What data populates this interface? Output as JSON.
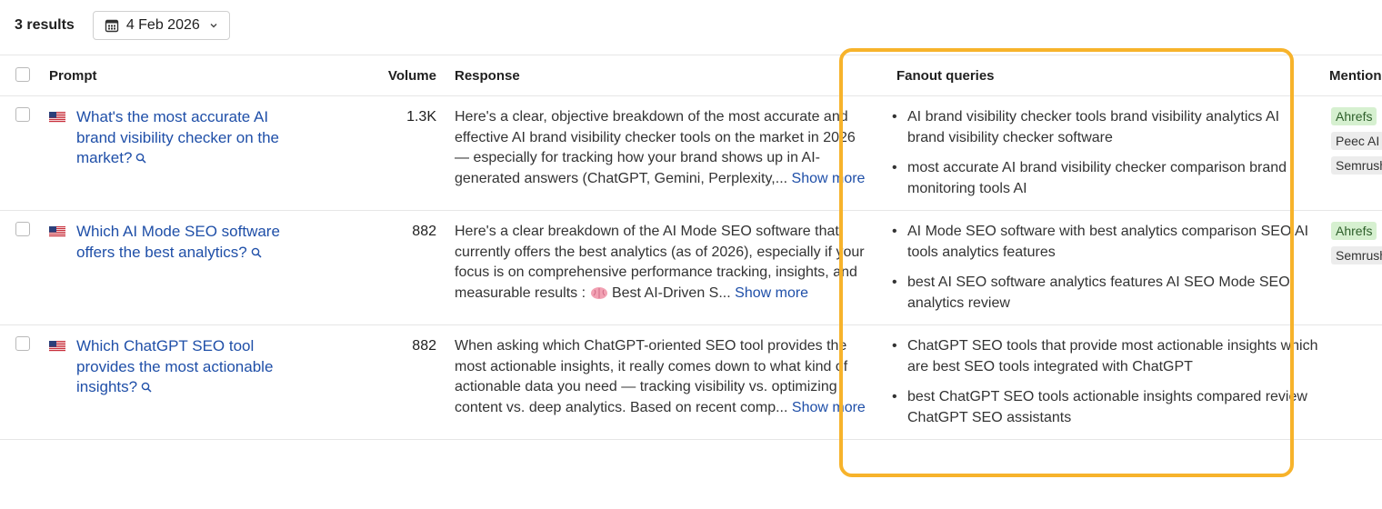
{
  "toolbar": {
    "results_label": "3 results",
    "date_label": "4 Feb 2026",
    "date_icon": "calendar-icon",
    "dropdown_icon": "chevron-down-icon"
  },
  "table": {
    "headers": {
      "prompt": "Prompt",
      "volume": "Volume",
      "response": "Response",
      "fanout": "Fanout queries",
      "mentions": "Mentions"
    },
    "rows": [
      {
        "prompt": "What's the most accurate AI brand visibility checker on the market?",
        "volume": "1.3K",
        "response": "Here's a clear, objective breakdown of the most accurate and effective AI brand visibility checker tools on the market in 2026 — especially for tracking how your brand shows up in AI-generated answers (ChatGPT, Gemini, Perplexity,...",
        "response_tail": "",
        "show_more": "Show more",
        "fanout": [
          "AI brand visibility checker tools brand visibility analytics AI brand visibility checker software",
          "most accurate AI brand visibility checker comparison brand monitoring tools AI"
        ],
        "mentions": [
          {
            "label": "Ahrefs",
            "color": "#d6f0d0"
          },
          {
            "label": "Peec AI",
            "color": "#ececec"
          },
          {
            "label": "Semrush",
            "color": "#ececec"
          }
        ]
      },
      {
        "prompt": "Which AI Mode SEO software offers the best analytics?",
        "volume": "882",
        "response": "Here's a clear breakdown of the AI Mode SEO software that currently offers the best analytics (as of 2026), especially if your focus is on comprehensive performance tracking, insights, and measurable results :",
        "response_tail": "Best AI-Driven S...",
        "show_more": "Show more",
        "fanout": [
          "AI Mode SEO software with best analytics comparison SEO AI tools analytics features",
          "best AI SEO software analytics features AI SEO Mode SEO analytics review"
        ],
        "mentions": [
          {
            "label": "Ahrefs",
            "color": "#d6f0d0"
          },
          {
            "label": "Semrush",
            "color": "#ececec"
          }
        ]
      },
      {
        "prompt": "Which ChatGPT SEO tool provides the most actionable insights?",
        "volume": "882",
        "response": "When asking which ChatGPT-oriented SEO tool provides the most actionable insights, it really comes down to what kind of actionable data you need — tracking visibility vs. optimizing content vs. deep analytics. Based on recent comp...",
        "response_tail": "",
        "show_more": "Show more",
        "fanout": [
          "ChatGPT SEO tools that provide most actionable insights which are best SEO tools integrated with ChatGPT",
          "best ChatGPT SEO tools actionable insights compared review ChatGPT SEO assistants"
        ],
        "mentions": []
      }
    ]
  },
  "highlight_color": "#f7b32b",
  "link_color": "#1f4fa8"
}
